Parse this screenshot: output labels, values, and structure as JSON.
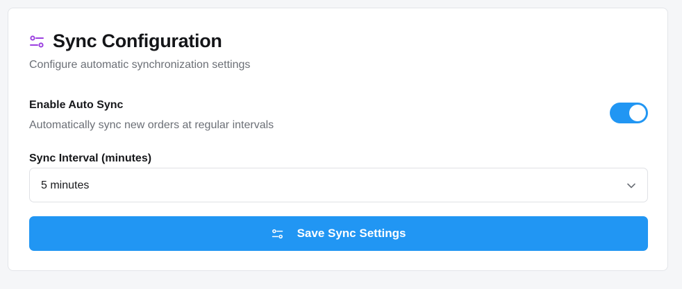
{
  "header": {
    "icon": "sliders-icon",
    "title": "Sync Configuration",
    "subtitle": "Configure automatic synchronization settings"
  },
  "auto_sync": {
    "label": "Enable Auto Sync",
    "description": "Automatically sync new orders at regular intervals",
    "enabled": true
  },
  "interval": {
    "label": "Sync Interval (minutes)",
    "selected": "5 minutes",
    "icon": "chevron-down-icon"
  },
  "save_button": {
    "label": "Save Sync Settings",
    "icon": "sliders-icon"
  },
  "colors": {
    "accent": "#2196f3",
    "header_icon": "#9b3fe0"
  }
}
